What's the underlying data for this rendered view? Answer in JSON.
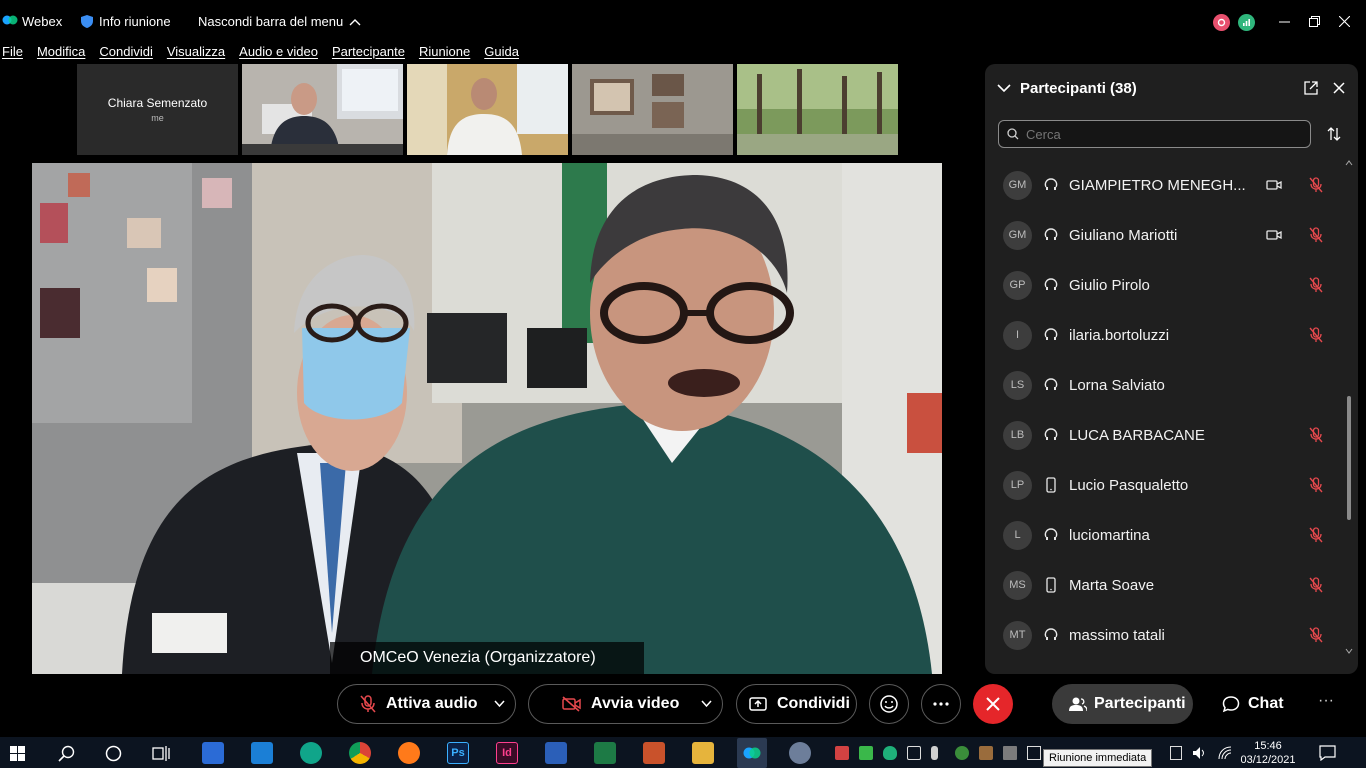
{
  "titlebar": {
    "app_name": "Webex",
    "meeting_info": "Info riunione",
    "hide_menu": "Nascondi barra del menu"
  },
  "menu": [
    "File",
    "Modifica",
    "Condividi",
    "Visualizza",
    "Audio e video",
    "Partecipante",
    "Riunione",
    "Guida"
  ],
  "thumbnails": {
    "self_name": "Chiara Semenzato",
    "self_sub": "me"
  },
  "main_video": {
    "caption": "OMCeO Venezia (Organizzatore)"
  },
  "panel": {
    "title": "Partecipanti (38)",
    "search_placeholder": "Cerca",
    "participants": [
      {
        "initials": "GM",
        "name": "GIAMPIETRO MENEGH...",
        "connection": "computer",
        "video": true,
        "muted": true
      },
      {
        "initials": "GM",
        "name": "Giuliano Mariotti",
        "connection": "computer",
        "video": true,
        "muted": true
      },
      {
        "initials": "GP",
        "name": "Giulio Pirolo",
        "connection": "computer",
        "video": false,
        "muted": true
      },
      {
        "initials": "I",
        "name": "ilaria.bortoluzzi",
        "connection": "computer",
        "video": false,
        "muted": true
      },
      {
        "initials": "LS",
        "name": "Lorna Salviato",
        "connection": "computer",
        "video": false,
        "muted": false
      },
      {
        "initials": "LB",
        "name": "LUCA BARBACANE",
        "connection": "computer",
        "video": false,
        "muted": true
      },
      {
        "initials": "LP",
        "name": "Lucio Pasqualetto",
        "connection": "mobile",
        "video": false,
        "muted": true
      },
      {
        "initials": "L",
        "name": "luciomartina",
        "connection": "computer",
        "video": false,
        "muted": true
      },
      {
        "initials": "MS",
        "name": "Marta Soave",
        "connection": "mobile",
        "video": false,
        "muted": true
      },
      {
        "initials": "MT",
        "name": "massimo tatali",
        "connection": "computer",
        "video": false,
        "muted": true
      }
    ]
  },
  "controls": {
    "audio": "Attiva audio",
    "video": "Avvia video",
    "share": "Condividi",
    "participants": "Partecipanti",
    "chat": "Chat",
    "more": "···"
  },
  "taskbar": {
    "time": "15:46",
    "date": "03/12/2021",
    "tooltip": "Riunione immediata"
  },
  "colors": {
    "end_call": "#e5262a",
    "mute_red": "#e5484d",
    "panel_bg": "#1f1f1f",
    "accent_webex": "#07c160"
  }
}
